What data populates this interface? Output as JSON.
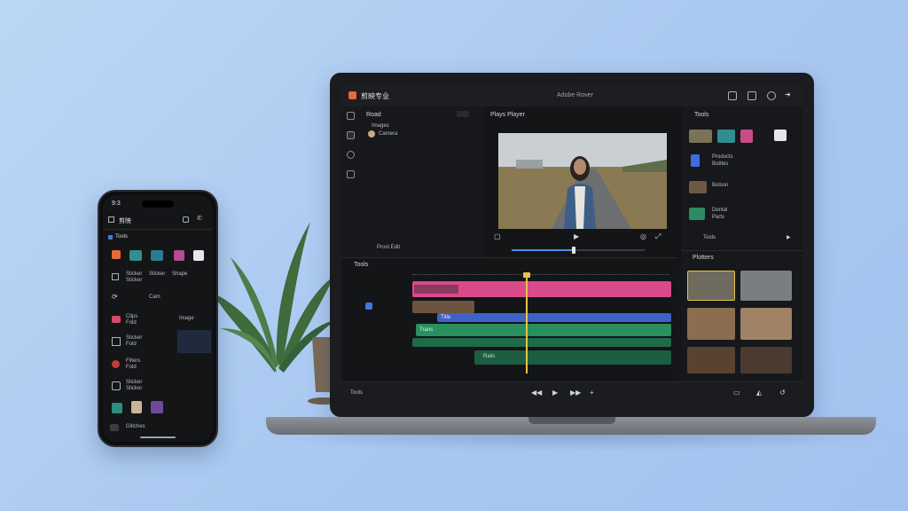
{
  "laptop": {
    "app_title": "剪映专业",
    "project_name": "Adobe Rover",
    "media_panel": {
      "header": "Road",
      "items": [
        "Images",
        "Camera"
      ],
      "footer": "Prost Edit"
    },
    "player": {
      "header": "Plays Player"
    },
    "assets": {
      "header": "Tools",
      "rows": [
        {
          "label": "Products",
          "sub": "Bottles"
        },
        {
          "label": "Bolson",
          "sub": ""
        },
        {
          "label": "Dental",
          "sub": "Parts"
        }
      ],
      "footer": "Tools"
    },
    "timeline": {
      "header": "Tools",
      "clip_labels": [
        "Title",
        "Trans",
        "Rails"
      ]
    },
    "clips_panel": {
      "header": "Plotters"
    },
    "bottombar": {
      "left_label": "Tools"
    },
    "colors": {
      "accent_pink": "#d94a8c",
      "accent_blue": "#3d63c7",
      "accent_green": "#2a8f5f",
      "playhead": "#e6c34a"
    }
  },
  "phone": {
    "time": "9:3",
    "header_title": "剪映",
    "section": "Tools",
    "rows": [
      {
        "label": "Sticker",
        "sub": "Sticker"
      },
      {
        "label": "Clips",
        "sub": "Fold"
      },
      {
        "label": "Image",
        "sub": ""
      },
      {
        "label": "Sticker",
        "sub": "Fold"
      },
      {
        "label": "Filters",
        "sub": "Fold"
      },
      {
        "label": "Sticker",
        "sub": "Sticker"
      },
      {
        "label": "Glitches",
        "sub": ""
      }
    ],
    "grid_labels": [
      "Sticker",
      "Shape",
      "Cam"
    ]
  }
}
